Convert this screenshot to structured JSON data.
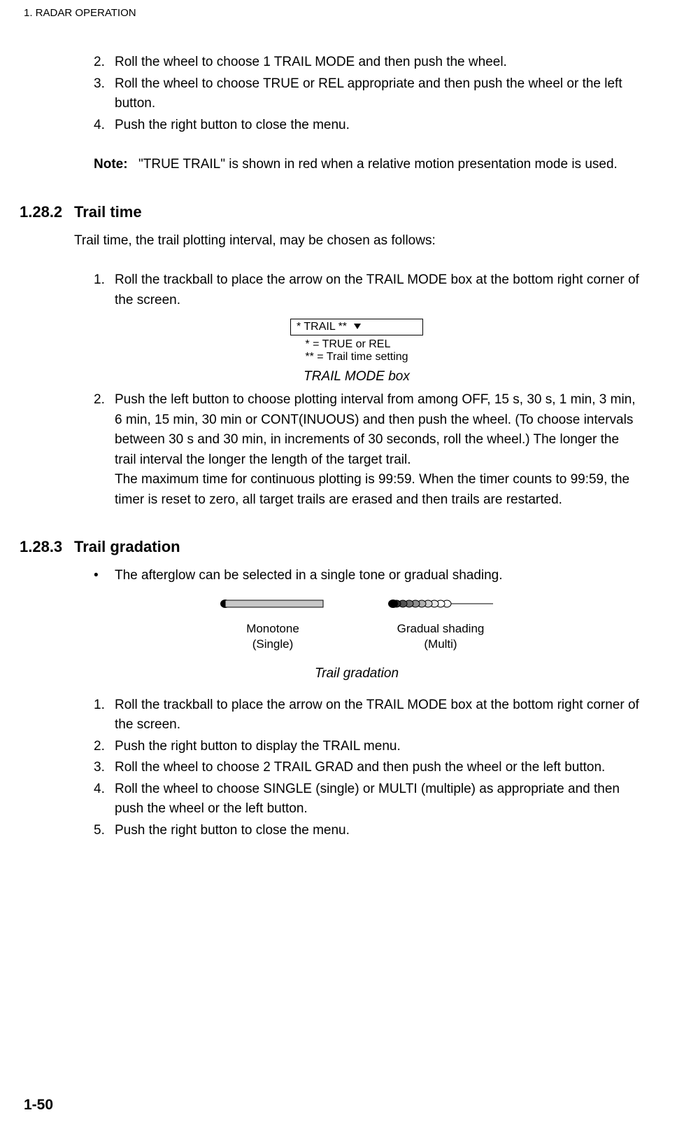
{
  "header": "1. RADAR OPERATION",
  "top_list": {
    "items": [
      {
        "num": "2.",
        "text": "Roll the wheel to choose 1 TRAIL MODE and then push the wheel."
      },
      {
        "num": "3.",
        "text": "Roll the wheel to choose TRUE or REL appropriate and then push the wheel or the left button."
      },
      {
        "num": "4.",
        "text": "Push the right button to close the menu."
      }
    ]
  },
  "note": {
    "label": "Note:",
    "text": "\"TRUE TRAIL\" is shown in red when a relative motion presentation mode is used."
  },
  "section_1282": {
    "num": "1.28.2",
    "title": "Trail time",
    "intro": "Trail time, the trail plotting interval, may be chosen as follows:",
    "list_1": {
      "num": "1.",
      "text": "Roll the trackball to place the arrow on the TRAIL MODE box at the bottom right corner of the screen."
    },
    "trail_box_text": "* TRAIL **",
    "legend_1": "*   = TRUE or REL",
    "legend_2": "** = Trail time setting",
    "caption": "TRAIL MODE box",
    "list_2": {
      "num": "2.",
      "text": "Push the left button to choose plotting interval from among OFF, 15 s, 30 s, 1 min, 3 min, 6 min, 15 min, 30 min or CONT(INUOUS) and then push the wheel. (To choose intervals between 30 s and 30 min, in increments of 30 seconds, roll the wheel.) The longer the trail interval the longer the length of the target trail.",
      "text2": "The maximum time for continuous plotting is 99:59. When the timer counts to 99:59, the timer is reset to zero, all target trails are erased and then trails are restarted."
    }
  },
  "section_1283": {
    "num": "1.28.3",
    "title": "Trail gradation",
    "bullet": "The afterglow can be selected in a single tone or gradual shading.",
    "mono_label1": "Monotone",
    "mono_label2": "(Single)",
    "grad_label1": "Gradual shading",
    "grad_label2": "(Multi)",
    "caption": "Trail gradation",
    "list": {
      "items": [
        {
          "num": "1.",
          "text": "Roll the trackball to place the arrow on the TRAIL MODE box at the bottom right corner of the screen."
        },
        {
          "num": "2.",
          "text": "Push the right button to display the TRAIL menu."
        },
        {
          "num": "3.",
          "text": "Roll the wheel to choose 2 TRAIL GRAD and then push the wheel or the left button."
        },
        {
          "num": "4.",
          "text": "Roll the wheel to choose SINGLE (single) or MULTI (multiple) as appropriate and then push the wheel or the left button."
        },
        {
          "num": "5.",
          "text": "Push the right button to close the menu."
        }
      ]
    }
  },
  "page_number": "1-50"
}
